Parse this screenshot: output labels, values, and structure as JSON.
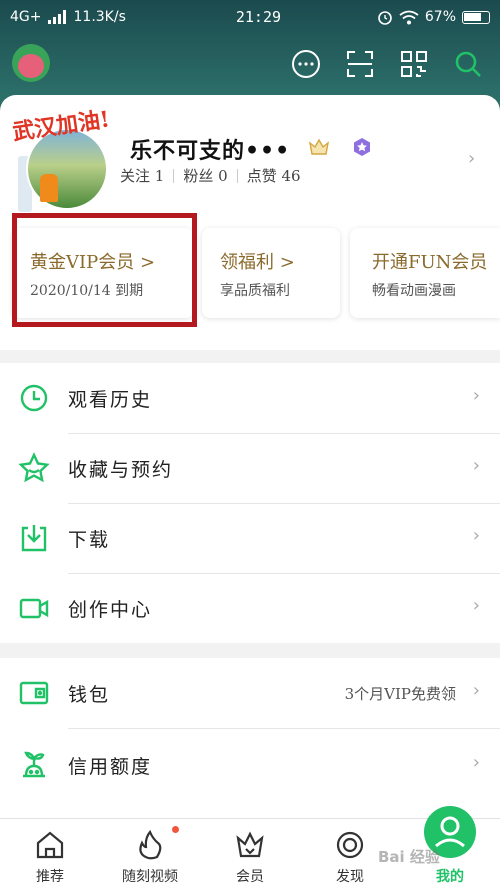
{
  "status_bar": {
    "network": "4G+",
    "speed": "11.3K/s",
    "time": "21:29",
    "battery": "67%"
  },
  "profile": {
    "sticker_text": "武汉加油!",
    "username": "乐不可支的•••",
    "stats": [
      {
        "label": "关注",
        "value": "1"
      },
      {
        "label": "粉丝",
        "value": "0"
      },
      {
        "label": "点赞",
        "value": "46"
      }
    ]
  },
  "vip_cards": [
    {
      "title": "黄金VIP会员",
      "arrow": ">",
      "subtitle": "2020/10/14 到期"
    },
    {
      "title": "领福利",
      "arrow": ">",
      "subtitle": "享品质福利"
    },
    {
      "title": "开通FUN会员",
      "subtitle": "畅看动画漫画"
    }
  ],
  "menu": {
    "group1": [
      {
        "label": "观看历史",
        "icon": "clock-icon"
      },
      {
        "label": "收藏与预约",
        "icon": "star-icon"
      },
      {
        "label": "下载",
        "icon": "download-icon"
      },
      {
        "label": "创作中心",
        "icon": "camera-icon"
      }
    ],
    "group2": [
      {
        "label": "钱包",
        "icon": "wallet-icon",
        "extra": "3个月VIP免费领"
      },
      {
        "label": "信用额度",
        "icon": "sprout-icon"
      }
    ]
  },
  "tabs": [
    {
      "label": "推荐",
      "icon": "home-icon"
    },
    {
      "label": "随刻视频",
      "icon": "flame-icon"
    },
    {
      "label": "会员",
      "icon": "crown-icon"
    },
    {
      "label": "发现",
      "icon": "discover-icon"
    },
    {
      "label": "我的",
      "icon": "profile-icon"
    }
  ],
  "watermark": "Bai 经验",
  "colors": {
    "accent": "#21c167",
    "header": "#1b4a4e",
    "vip_gold": "#8a6a2b",
    "highlight_box": "#b3191f"
  }
}
